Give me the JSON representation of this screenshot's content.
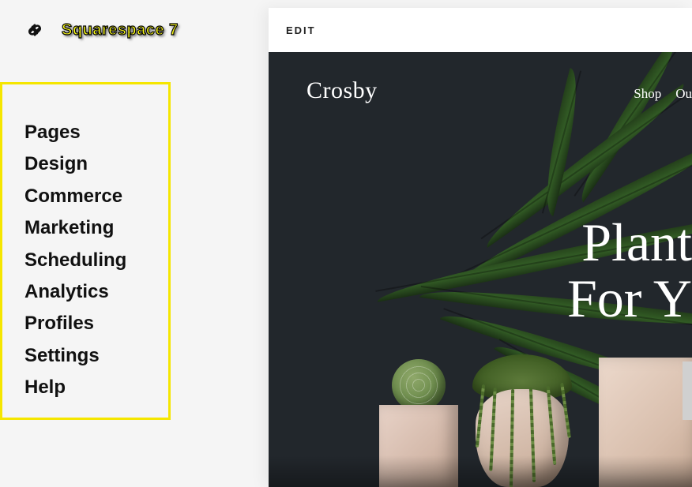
{
  "annotation": {
    "label": "Squarespace 7"
  },
  "sidebar": {
    "items": [
      {
        "label": "Pages"
      },
      {
        "label": "Design"
      },
      {
        "label": "Commerce"
      },
      {
        "label": "Marketing"
      },
      {
        "label": "Scheduling"
      },
      {
        "label": "Analytics"
      },
      {
        "label": "Profiles"
      },
      {
        "label": "Settings"
      },
      {
        "label": "Help"
      }
    ]
  },
  "preview": {
    "edit_label": "EDIT",
    "site_title": "Crosby",
    "nav": [
      {
        "label": "Shop"
      },
      {
        "label": "Ou"
      }
    ],
    "hero": {
      "line1": "Plant",
      "line2": "For Y"
    }
  }
}
